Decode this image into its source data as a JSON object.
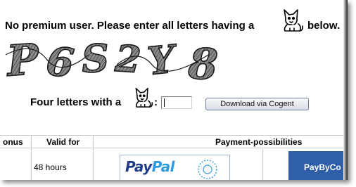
{
  "notice": {
    "text": "No premium user. Please enter all letters having a",
    "text_end": "below."
  },
  "captcha": {
    "characters": [
      "P",
      "6",
      "S",
      "2",
      "Y",
      "8"
    ],
    "colors": {
      "stroke": "#1a1a1a",
      "fill": "#6a6a6a"
    }
  },
  "cat_icon": "cat-icon",
  "form": {
    "label": "Four letters with a",
    "colon": ":",
    "input_value": "",
    "button_label": "Download via Cogent"
  },
  "table": {
    "headers": [
      "onus",
      "Valid for",
      "Payment-possibilities"
    ],
    "rows": [
      {
        "valid_for": "48 hours"
      }
    ],
    "payment": {
      "paypal_part1": "Pay",
      "paypal_part2": "Pal",
      "paybycc": "PayByCo"
    }
  },
  "colors": {
    "paypal_blue": "#1f3c88",
    "paypal_light": "#2d9be0",
    "pbc_blue": "#2f5fa8",
    "button_border": "#6e7d96"
  }
}
